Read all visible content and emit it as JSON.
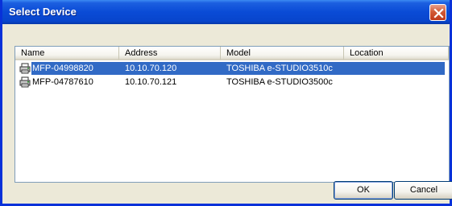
{
  "window": {
    "title": "Select Device"
  },
  "columns": [
    {
      "label": "Name"
    },
    {
      "label": "Address"
    },
    {
      "label": "Model"
    },
    {
      "label": "Location"
    }
  ],
  "rows": [
    {
      "name": "MFP-04998820",
      "address": "10.10.70.120",
      "model": "TOSHIBA e-STUDIO3510c",
      "location": "",
      "selected": true,
      "icon": "printer-icon"
    },
    {
      "name": "MFP-04787610",
      "address": "10.10.70.121",
      "model": "TOSHIBA e-STUDIO3500c",
      "location": "",
      "selected": false,
      "icon": "printer-icon"
    }
  ],
  "buttons": {
    "ok_label": "OK",
    "cancel_label": "Cancel"
  },
  "colors": {
    "title_bar": "#0a4bd6",
    "selection": "#316ac5",
    "dialog_bg": "#ece9d8"
  }
}
